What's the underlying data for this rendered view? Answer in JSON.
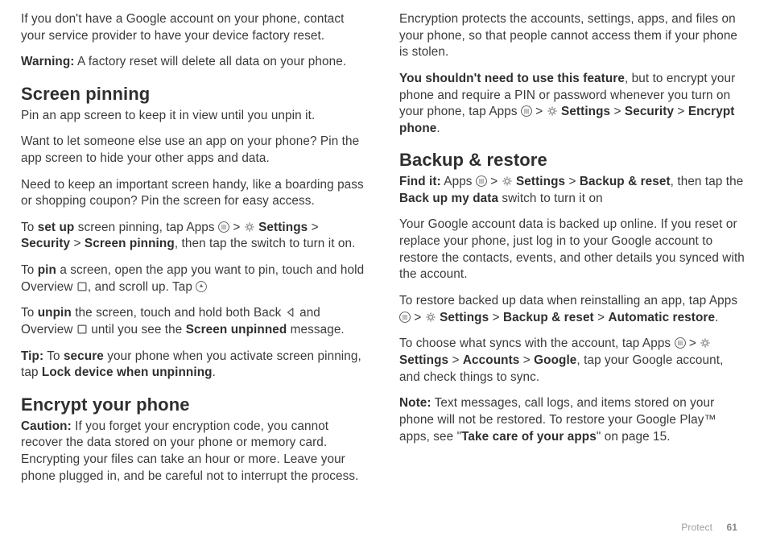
{
  "left": {
    "intro1": "If you don't have a Google account on your phone, contact your service provider to have your device factory reset.",
    "warningLabel": "Warning:",
    "warningText": " A factory reset will delete all data on your phone.",
    "h_pin": "Screen pinning",
    "pin_p1": "Pin an app screen to keep it in view until you unpin it.",
    "pin_p2": "Want to let someone else use an app on your phone? Pin the app screen to hide your other apps and data.",
    "pin_p3": "Need to keep an important screen handy, like a boarding pass or shopping coupon? Pin the screen for easy access.",
    "pin_setup_a": "To ",
    "pin_setup_b": "set up",
    "pin_setup_c": " screen pinning, tap Apps ",
    "pin_setup_d": " > ",
    "pin_setup_e": " Settings",
    "pin_setup_f": " > ",
    "pin_setup_g": "Security",
    "pin_setup_h": " > ",
    "pin_setup_i": "Screen pinning",
    "pin_setup_j": ", then tap the switch to turn it on.",
    "pin_do_a": "To ",
    "pin_do_b": "pin",
    "pin_do_c": " a screen, open the app you want to pin, touch and hold Overview ",
    "pin_do_d": ", and scroll up. Tap ",
    "unpin_a": "To ",
    "unpin_b": "unpin",
    "unpin_c": " the screen, touch and hold both Back ",
    "unpin_d": " and Overview ",
    "unpin_e": " until you see the ",
    "unpin_f": "Screen unpinned",
    "unpin_g": " message.",
    "tip_a": "Tip:",
    "tip_b": " To ",
    "tip_c": "secure",
    "tip_d": " your phone when you activate screen pinning, tap ",
    "tip_e": "Lock device when unpinning",
    "tip_f": ".",
    "h_encrypt": "Encrypt your phone",
    "enc_a": "Caution:",
    "enc_b": " If you forget your encryption code, you cannot recover the data stored on your phone or memory card. Encrypting your files can take an hour or more. Leave your phone plugged in, and be careful not to interrupt the process."
  },
  "right": {
    "enc2": "Encryption protects the accounts, settings, apps, and files on your phone, so that people cannot access them if your phone is stolen.",
    "enc3_a": "You shouldn't need to use this feature",
    "enc3_b": ", but to encrypt your phone and require a PIN or password whenever you turn on your phone, tap Apps ",
    "enc3_c": " > ",
    "enc3_d": " Settings",
    "enc3_e": " > ",
    "enc3_f": "Security",
    "enc3_g": " > ",
    "enc3_h": "Encrypt phone",
    "enc3_i": ".",
    "h_backup": "Backup & restore",
    "find_a": "Find it:",
    "find_b": " Apps ",
    "find_c": " > ",
    "find_d": " Settings",
    "find_e": " > ",
    "find_f": "Backup & reset",
    "find_g": ", then tap the ",
    "find_h": "Back up my data",
    "find_i": " switch to turn it on",
    "bk_p1": "Your Google account data is backed up online. If you reset or replace your phone, just log in to your Google account to restore the contacts, events, and other details you synced with the account.",
    "bk_p2_a": "To restore backed up data when reinstalling an app, tap Apps ",
    "bk_p2_b": " > ",
    "bk_p2_c": " Settings",
    "bk_p2_d": " > ",
    "bk_p2_e": "Backup & reset",
    "bk_p2_f": " > ",
    "bk_p2_g": "Automatic restore",
    "bk_p2_h": ".",
    "bk_p3_a": "To choose what syncs with the account, tap Apps ",
    "bk_p3_b": " > ",
    "bk_p3_c": " Settings",
    "bk_p3_d": " > ",
    "bk_p3_e": "Accounts",
    "bk_p3_f": " > ",
    "bk_p3_g": "Google",
    "bk_p3_h": ", tap your Google account, and check things to sync.",
    "note_a": "Note:",
    "note_b": " Text messages, call logs, and items stored on your phone will not be restored. To restore your Google Play™ apps, see \"",
    "note_c": "Take care of your apps",
    "note_d": "\" on page 15."
  },
  "footer": {
    "section": "Protect",
    "page": "61"
  }
}
